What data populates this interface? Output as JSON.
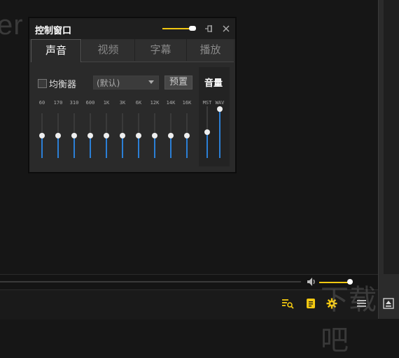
{
  "background": {
    "partial_text": "er"
  },
  "panel": {
    "title": "控制窗口",
    "tabs": [
      {
        "label": "声音",
        "active": true
      },
      {
        "label": "视频",
        "active": false
      },
      {
        "label": "字幕",
        "active": false
      },
      {
        "label": "播放",
        "active": false
      }
    ],
    "equalizer": {
      "enable_label": "均衡器",
      "enabled": false,
      "preset_value": "(默认)",
      "preset_button": "预置",
      "bands": [
        {
          "label": "60",
          "level": 0.5
        },
        {
          "label": "170",
          "level": 0.5
        },
        {
          "label": "310",
          "level": 0.5
        },
        {
          "label": "600",
          "level": 0.5
        },
        {
          "label": "1K",
          "level": 0.5
        },
        {
          "label": "3K",
          "level": 0.5
        },
        {
          "label": "6K",
          "level": 0.5
        },
        {
          "label": "12K",
          "level": 0.5
        },
        {
          "label": "14K",
          "level": 0.5
        },
        {
          "label": "16K",
          "level": 0.5
        }
      ]
    },
    "volume": {
      "title": "音量",
      "channels": [
        {
          "label": "MST",
          "level": 0.5
        },
        {
          "label": "WAV",
          "level": 0.95
        }
      ]
    }
  },
  "player": {
    "volume_level": 0.95,
    "toolbar_icons": [
      "playlist-search-icon",
      "notes-icon",
      "settings-icon",
      "menu-icon",
      "minimize-icon"
    ]
  },
  "colors": {
    "accent": "#f2c811",
    "slider_fill": "#2b7fd6"
  }
}
